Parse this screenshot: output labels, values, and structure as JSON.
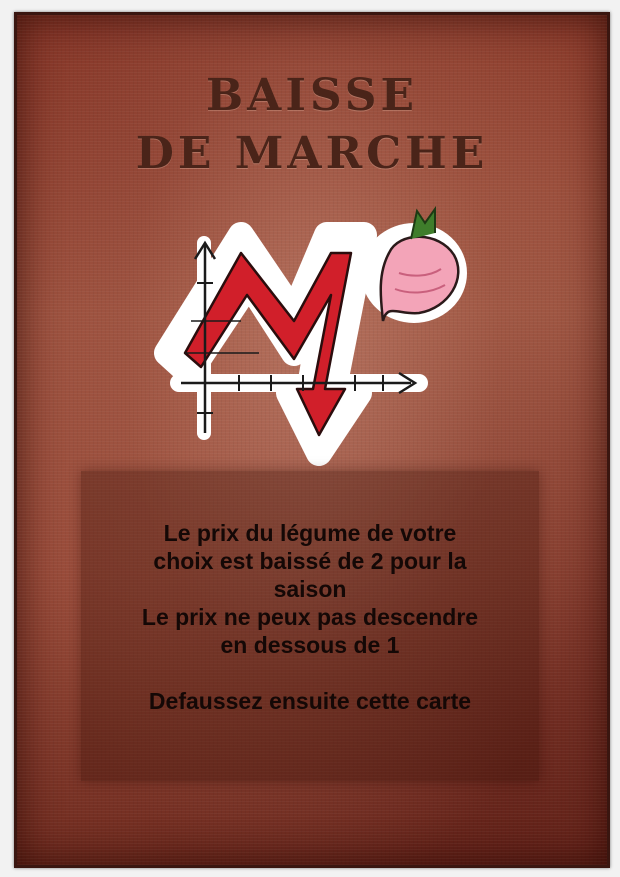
{
  "card": {
    "title_line1": "BAISSE",
    "title_line2": "DE MARCHE",
    "icon": "price-drop-radish-icon",
    "text": {
      "line1": "Le prix du légume de votre",
      "line2": "choix est baissé de 2 pour la",
      "line3": "saison",
      "line4": "Le prix ne peux pas descendre",
      "line5": "en dessous de 1",
      "line6": "Defaussez ensuite cette carte"
    }
  },
  "colors": {
    "title": "#4a2419",
    "arrow": "#d11f2a",
    "radish": "#f3a4b8",
    "leaf": "#3f7d2b",
    "text": "#140806"
  }
}
